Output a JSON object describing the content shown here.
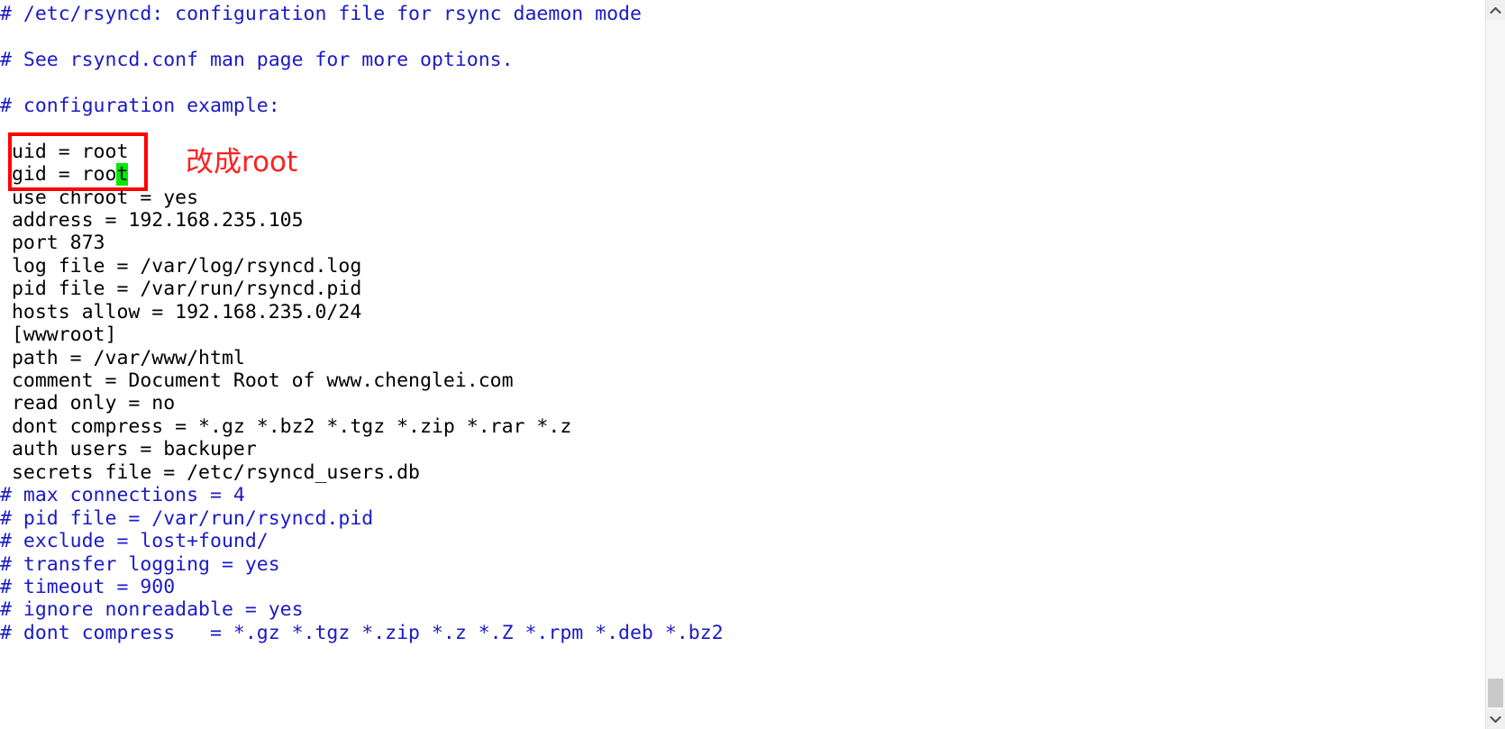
{
  "document": {
    "name": "rsyncd.conf",
    "comment_color": "#1a1ac8",
    "text_color": "#000000",
    "background": "#ffffff",
    "lines": [
      {
        "kind": "comment",
        "text": "# /etc/rsyncd: configuration file for rsync daemon mode"
      },
      {
        "kind": "blank",
        "text": ""
      },
      {
        "kind": "comment",
        "text": "# See rsyncd.conf man page for more options."
      },
      {
        "kind": "blank",
        "text": ""
      },
      {
        "kind": "comment",
        "text": "# configuration example:"
      },
      {
        "kind": "blank",
        "text": ""
      },
      {
        "kind": "config",
        "text": " uid = root"
      },
      {
        "kind": "config-cursor",
        "text": " gid = roo",
        "cursor_char": "t"
      },
      {
        "kind": "config",
        "text": " use chroot = yes"
      },
      {
        "kind": "config",
        "text": " address = 192.168.235.105"
      },
      {
        "kind": "config",
        "text": " port 873"
      },
      {
        "kind": "config",
        "text": " log file = /var/log/rsyncd.log"
      },
      {
        "kind": "config",
        "text": " pid file = /var/run/rsyncd.pid"
      },
      {
        "kind": "config",
        "text": " hosts allow = 192.168.235.0/24"
      },
      {
        "kind": "config",
        "text": " [wwwroot]"
      },
      {
        "kind": "config",
        "text": " path = /var/www/html"
      },
      {
        "kind": "config",
        "text": " comment = Document Root of www.chenglei.com"
      },
      {
        "kind": "config",
        "text": " read only = no"
      },
      {
        "kind": "config",
        "text": " dont compress = *.gz *.bz2 *.tgz *.zip *.rar *.z"
      },
      {
        "kind": "config",
        "text": " auth users = backuper"
      },
      {
        "kind": "config",
        "text": " secrets file = /etc/rsyncd_users.db"
      },
      {
        "kind": "comment",
        "text": "# max connections = 4"
      },
      {
        "kind": "comment",
        "text": "# pid file = /var/run/rsyncd.pid"
      },
      {
        "kind": "comment",
        "text": "# exclude = lost+found/"
      },
      {
        "kind": "comment",
        "text": "# transfer logging = yes"
      },
      {
        "kind": "comment",
        "text": "# timeout = 900"
      },
      {
        "kind": "comment",
        "text": "# ignore nonreadable = yes"
      },
      {
        "kind": "comment",
        "text": "# dont compress   = *.gz *.tgz *.zip *.z *.Z *.rpm *.deb *.bz2"
      }
    ]
  },
  "annotation": {
    "highlight_box_color": "#ff0000",
    "note_text": "改成root",
    "note_color": "#ff2020",
    "cursor_highlight_color": "#00ea00",
    "cursor_char": "t"
  },
  "scrollbar": {
    "up_arrow": "chevron-up-icon",
    "down_arrow": "chevron-down-icon",
    "track_color": "#f0f0f0",
    "thumb_color": "#c9c9c9"
  }
}
